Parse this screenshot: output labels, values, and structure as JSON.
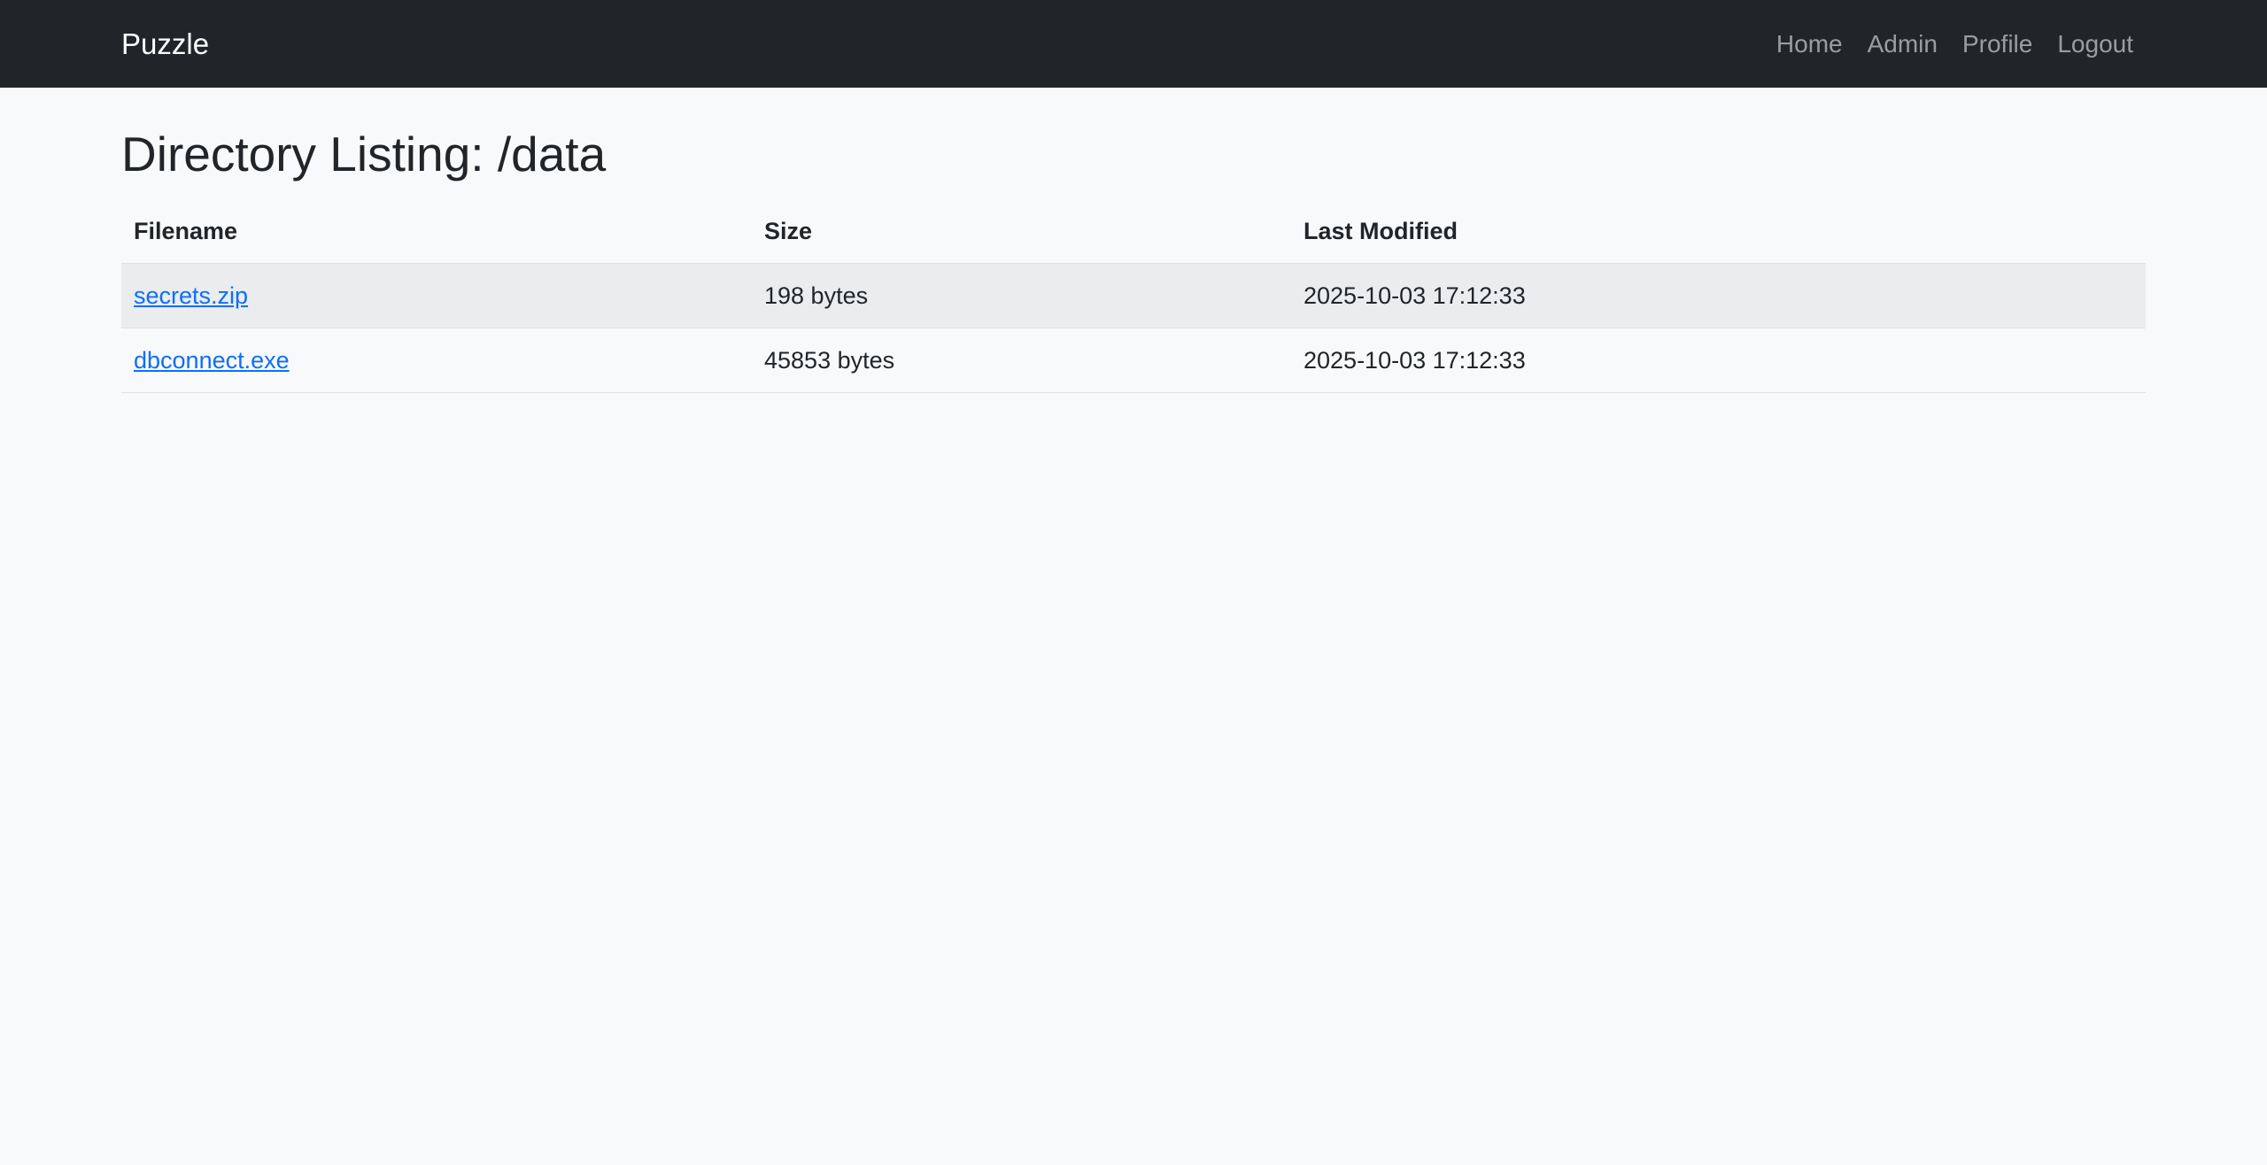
{
  "navbar": {
    "brand": "Puzzle",
    "links": [
      "Home",
      "Admin",
      "Profile",
      "Logout"
    ]
  },
  "page": {
    "title": "Directory Listing: /data"
  },
  "table": {
    "headers": [
      "Filename",
      "Size",
      "Last Modified"
    ],
    "rows": [
      {
        "filename": "secrets.zip",
        "size": "198 bytes",
        "modified": "2025-10-03 17:12:33"
      },
      {
        "filename": "dbconnect.exe",
        "size": "45853 bytes",
        "modified": "2025-10-03 17:12:33"
      }
    ]
  },
  "colors": {
    "navbar_bg": "#212529",
    "page_bg": "#f8f9fa",
    "link": "#0d6efd",
    "stripe": "#ebecee"
  }
}
